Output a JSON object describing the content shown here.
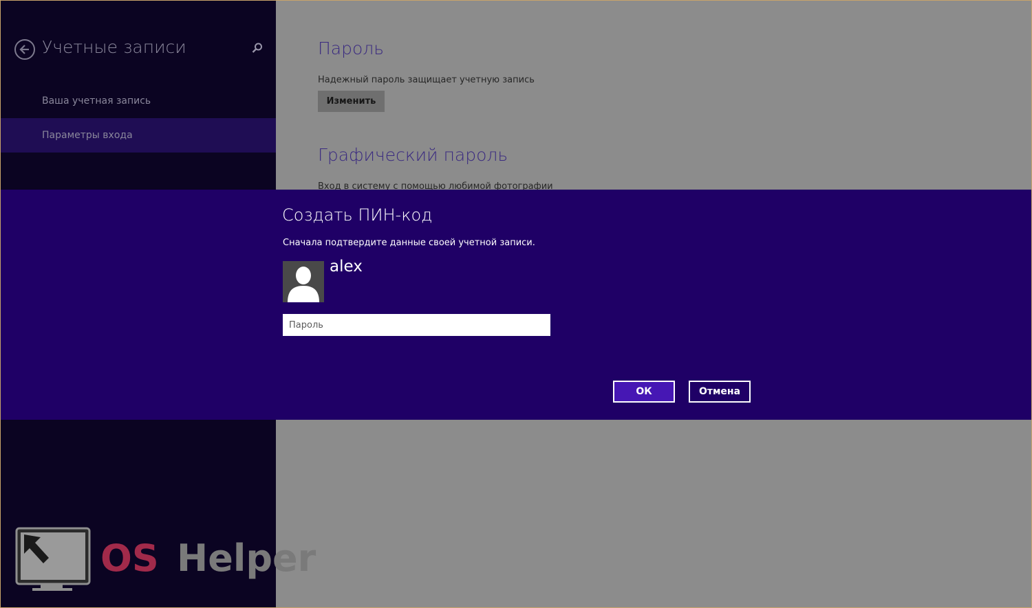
{
  "sidebar": {
    "title": "Учетные записи",
    "back_icon": "back-arrow-icon",
    "search_icon": "search-icon",
    "items": [
      {
        "label": "Ваша учетная запись",
        "selected": false
      },
      {
        "label": "Параметры входа",
        "selected": true
      }
    ]
  },
  "content": {
    "password_section": {
      "title": "Пароль",
      "description": "Надежный пароль защищает учетную запись",
      "button_label": "Изменить"
    },
    "picture_password_section": {
      "title": "Графический пароль",
      "description": "Вход в систему с помощью любимой фотографии"
    }
  },
  "dialog": {
    "title": "Создать ПИН-код",
    "subtitle": "Сначала подтвердите данные своей учетной записи.",
    "username": "alex",
    "password_placeholder": "Пароль",
    "password_value": "",
    "ok_label": "ОК",
    "cancel_label": "Отмена"
  },
  "watermark": {
    "text_os": "OS",
    "text_helper": "Helper"
  },
  "colors": {
    "dialog_bg": "#1f0066",
    "ok_bg": "#4617b4",
    "sidebar_bg": "#0b0422",
    "sidebar_selected": "#1f0d54",
    "content_bg": "#8c8c8c",
    "watermark_red": "#a12a4a"
  }
}
